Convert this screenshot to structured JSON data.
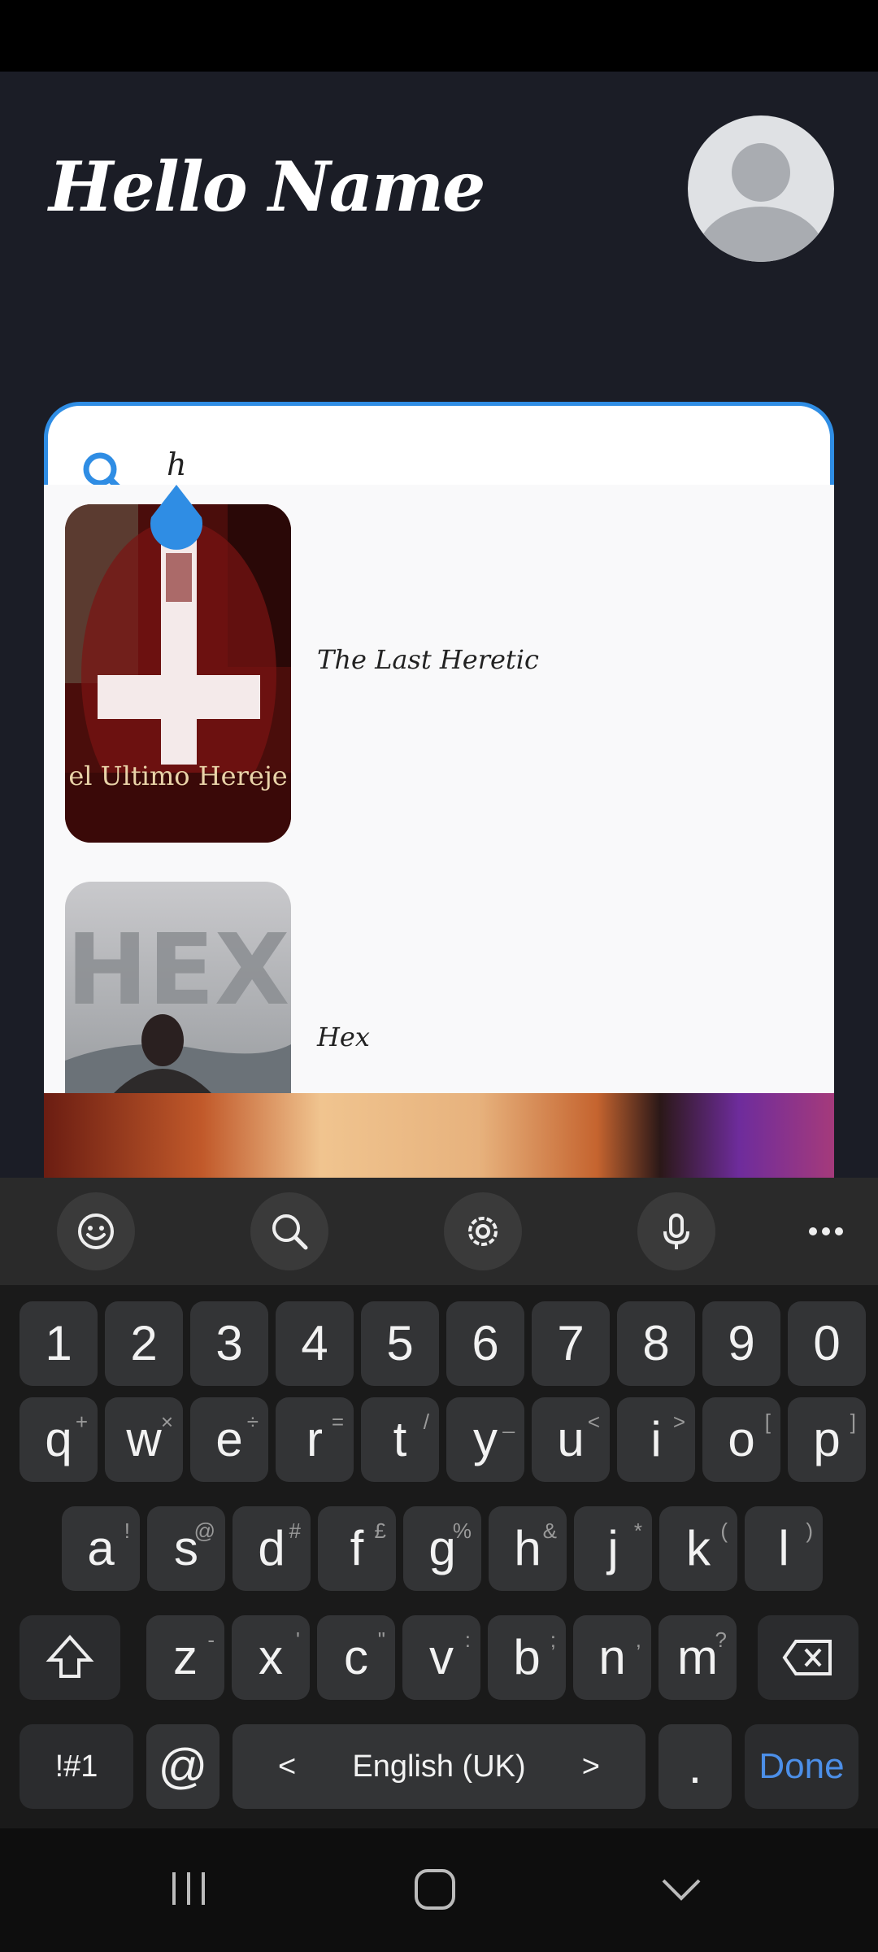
{
  "header": {
    "greeting": "Hello Name"
  },
  "search": {
    "value": "h"
  },
  "results": [
    {
      "title": "The Last Heretic",
      "poster_text": "el Ultimo Hereje"
    },
    {
      "title": "Hex",
      "poster_text": "HEX"
    }
  ],
  "keyboard": {
    "number_row": [
      "1",
      "2",
      "3",
      "4",
      "5",
      "6",
      "7",
      "8",
      "9",
      "0"
    ],
    "row1": [
      {
        "k": "q",
        "h": "+"
      },
      {
        "k": "w",
        "h": "×"
      },
      {
        "k": "e",
        "h": "÷"
      },
      {
        "k": "r",
        "h": "="
      },
      {
        "k": "t",
        "h": "/"
      },
      {
        "k": "y",
        "h": "_"
      },
      {
        "k": "u",
        "h": "<"
      },
      {
        "k": "i",
        "h": ">"
      },
      {
        "k": "o",
        "h": "["
      },
      {
        "k": "p",
        "h": "]"
      }
    ],
    "row2": [
      {
        "k": "a",
        "h": "!"
      },
      {
        "k": "s",
        "h": "@"
      },
      {
        "k": "d",
        "h": "#"
      },
      {
        "k": "f",
        "h": "£"
      },
      {
        "k": "g",
        "h": "%"
      },
      {
        "k": "h",
        "h": "&"
      },
      {
        "k": "j",
        "h": "*"
      },
      {
        "k": "k",
        "h": "("
      },
      {
        "k": "l",
        "h": ")"
      }
    ],
    "row3": [
      {
        "k": "z",
        "h": "-"
      },
      {
        "k": "x",
        "h": "'"
      },
      {
        "k": "c",
        "h": "\""
      },
      {
        "k": "v",
        "h": ":"
      },
      {
        "k": "b",
        "h": ";"
      },
      {
        "k": "n",
        "h": ","
      },
      {
        "k": "m",
        "h": "?"
      }
    ],
    "symbols_label": "!#1",
    "at_label": "@",
    "language_label": "English (UK)",
    "left_arrow": "<",
    "right_arrow": ">",
    "period_label": ".",
    "done_label": "Done"
  },
  "colors": {
    "accent": "#2f8de4",
    "done": "#4c8fe8",
    "background": "#1b1d26"
  }
}
